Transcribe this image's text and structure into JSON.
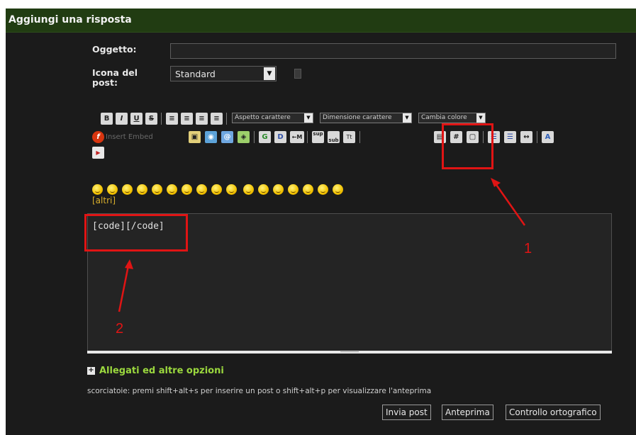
{
  "header": {
    "title": "Aggiungi una risposta"
  },
  "form": {
    "subject_label": "Oggetto:",
    "subject_value": "",
    "icon_label": "Icona del post:",
    "icon_select_value": "Standard"
  },
  "toolbar": {
    "font_face_select": "Aspetto carattere",
    "font_size_select": "Dimensione carattere",
    "color_select": "Cambia colore",
    "embed_text": "Insert Embed",
    "buttons": [
      {
        "name": "bold",
        "glyph": "B"
      },
      {
        "name": "italic",
        "glyph": "I"
      },
      {
        "name": "underline",
        "glyph": "U"
      },
      {
        "name": "strikethrough",
        "glyph": "S"
      },
      {
        "name": "align-left",
        "glyph": "≡"
      },
      {
        "name": "align-center",
        "glyph": "≡"
      },
      {
        "name": "align-right",
        "glyph": "≡"
      },
      {
        "name": "justify",
        "glyph": "≡"
      },
      {
        "name": "flash",
        "glyph": "f"
      },
      {
        "name": "image",
        "glyph": "▣"
      },
      {
        "name": "link",
        "glyph": "◉"
      },
      {
        "name": "email",
        "glyph": "@"
      },
      {
        "name": "attach",
        "glyph": "◈"
      },
      {
        "name": "google",
        "glyph": "G"
      },
      {
        "name": "wikipedia",
        "glyph": "D"
      },
      {
        "name": "move",
        "glyph": "←M"
      },
      {
        "name": "superscript",
        "glyph": "sup"
      },
      {
        "name": "subscript",
        "glyph": "sub"
      },
      {
        "name": "teletype",
        "glyph": "Tt"
      },
      {
        "name": "quote",
        "glyph": "▤"
      },
      {
        "name": "code",
        "glyph": "#"
      },
      {
        "name": "spoiler",
        "glyph": "▢"
      },
      {
        "name": "bullet-list",
        "glyph": "☰"
      },
      {
        "name": "numbered-list",
        "glyph": "☰"
      },
      {
        "name": "horizontal-rule",
        "glyph": "↔"
      },
      {
        "name": "remove-format",
        "glyph": "A"
      },
      {
        "name": "media",
        "glyph": "▶"
      }
    ]
  },
  "smilies": {
    "more_link": "[altri]",
    "count": 17
  },
  "editor": {
    "content": "[code][/code]"
  },
  "attachments": {
    "toggle": "+",
    "label": "Allegati ed altre opzioni"
  },
  "shortcuts_text": "scorciatoie: premi shift+alt+s per inserire un post o shift+alt+p per visualizzare l'anteprima",
  "actions": {
    "submit": "Invia post",
    "preview": "Anteprima",
    "spellcheck": "Controllo ortografico"
  },
  "annotations": {
    "note_1": "1",
    "note_2": "2",
    "color": "#e01414"
  },
  "colors": {
    "header_bg": "#213c12",
    "panel_bg": "#1b1b1b",
    "accent_green": "#9bd83e",
    "link_gold": "#d8ae2c"
  }
}
